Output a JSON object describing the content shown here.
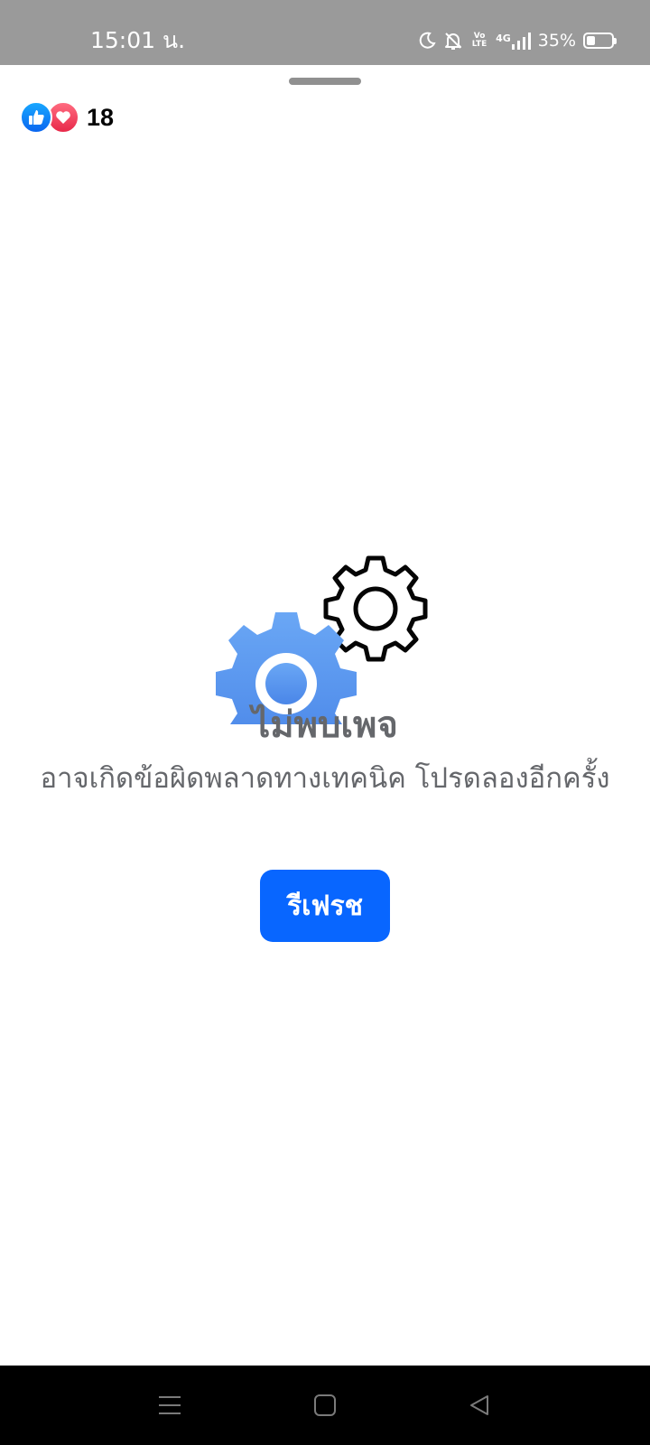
{
  "status_bar": {
    "time": "15:01 น.",
    "volte_top": "Vo",
    "volte_bottom": "LTE",
    "network": "4G",
    "battery_percent": "35%",
    "battery_level": 0.35,
    "icons": [
      "moon-icon",
      "bell-off-icon",
      "volte-icon",
      "signal-icon",
      "battery-icon"
    ]
  },
  "reactions": {
    "icons": [
      "like-icon",
      "love-icon"
    ],
    "count": "18"
  },
  "error": {
    "illustration": "gears-icon",
    "title": "ไม่พบเพจ",
    "message": "อาจเกิดข้อผิดพลาดทางเทคนิค โปรดลองอีกครั้ง",
    "button_label": "รีเฟรช"
  },
  "colors": {
    "accent": "#0866FF",
    "gear_blue": "#5B9BF0",
    "text_secondary": "#65676B",
    "status_bar_bg": "#9A9A9A",
    "nav_bar_bg": "#000000"
  },
  "nav_bar": {
    "buttons": [
      "menu-icon",
      "home-icon",
      "back-icon"
    ]
  }
}
